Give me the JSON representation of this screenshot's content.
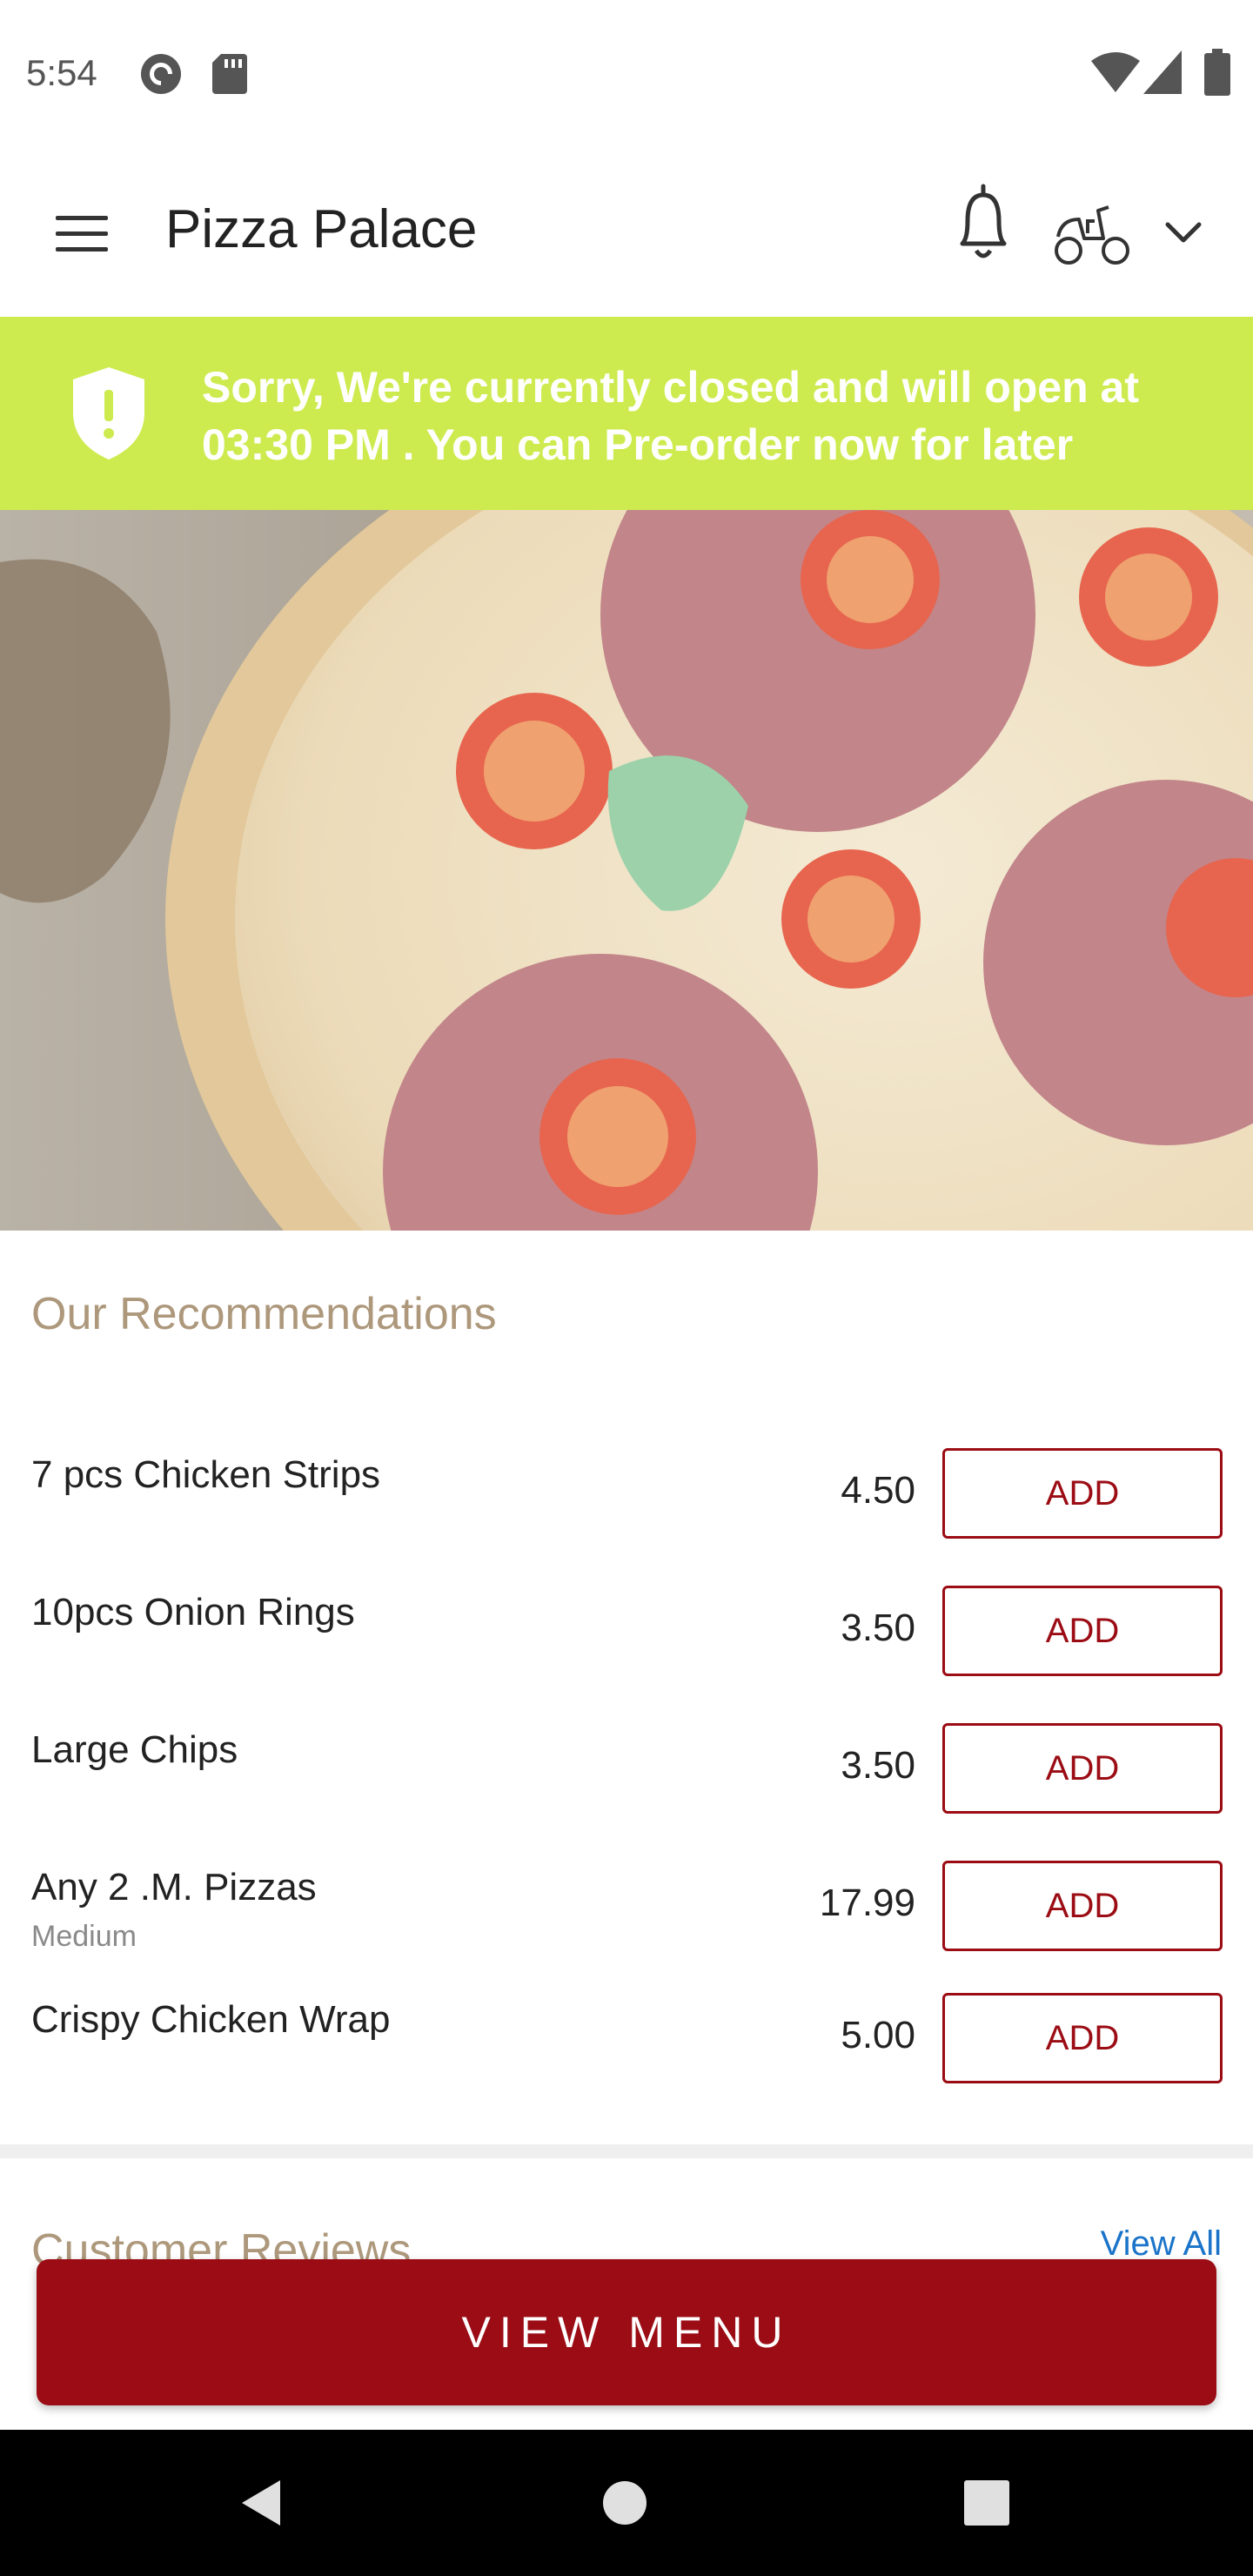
{
  "status_bar": {
    "time": "5:54",
    "icons": [
      "pocket-casts-icon",
      "sd-card-icon",
      "wifi-icon",
      "signal-icon",
      "battery-icon"
    ]
  },
  "app_bar": {
    "title": "Pizza Palace",
    "icons": [
      "hamburger-menu-icon",
      "bell-icon",
      "scooter-icon",
      "chevron-down-icon"
    ]
  },
  "notice": {
    "icon": "shield-alert-icon",
    "text": "Sorry, We're currently closed and will open at 03:30 PM . You can Pre-order now for later",
    "background": "#cdeb4f"
  },
  "hero": {
    "alt": "pizza-photo"
  },
  "recommendations": {
    "title": "Our Recommendations",
    "items": [
      {
        "name": "7 pcs Chicken Strips",
        "subtitle": "",
        "price": "4.50",
        "button": "ADD"
      },
      {
        "name": "10pcs Onion Rings",
        "subtitle": "",
        "price": "3.50",
        "button": "ADD"
      },
      {
        "name": "Large Chips",
        "subtitle": "",
        "price": "3.50",
        "button": "ADD"
      },
      {
        "name": "Any 2 .M. Pizzas",
        "subtitle": "Medium",
        "price": "17.99",
        "button": "ADD"
      },
      {
        "name": "Crispy Chicken Wrap",
        "subtitle": "",
        "price": "5.00",
        "button": "ADD"
      }
    ]
  },
  "reviews": {
    "title": "Customer Reviews",
    "link": "View All"
  },
  "view_menu": {
    "label": "VIEW MENU"
  },
  "nav_bar": {
    "icons": [
      "back-icon",
      "home-icon",
      "recents-icon"
    ]
  },
  "colors": {
    "brand_red": "#9b0c14",
    "accent_gold": "#ad987c",
    "banner_green": "#cdeb4f",
    "link_blue": "#1b74c9"
  }
}
